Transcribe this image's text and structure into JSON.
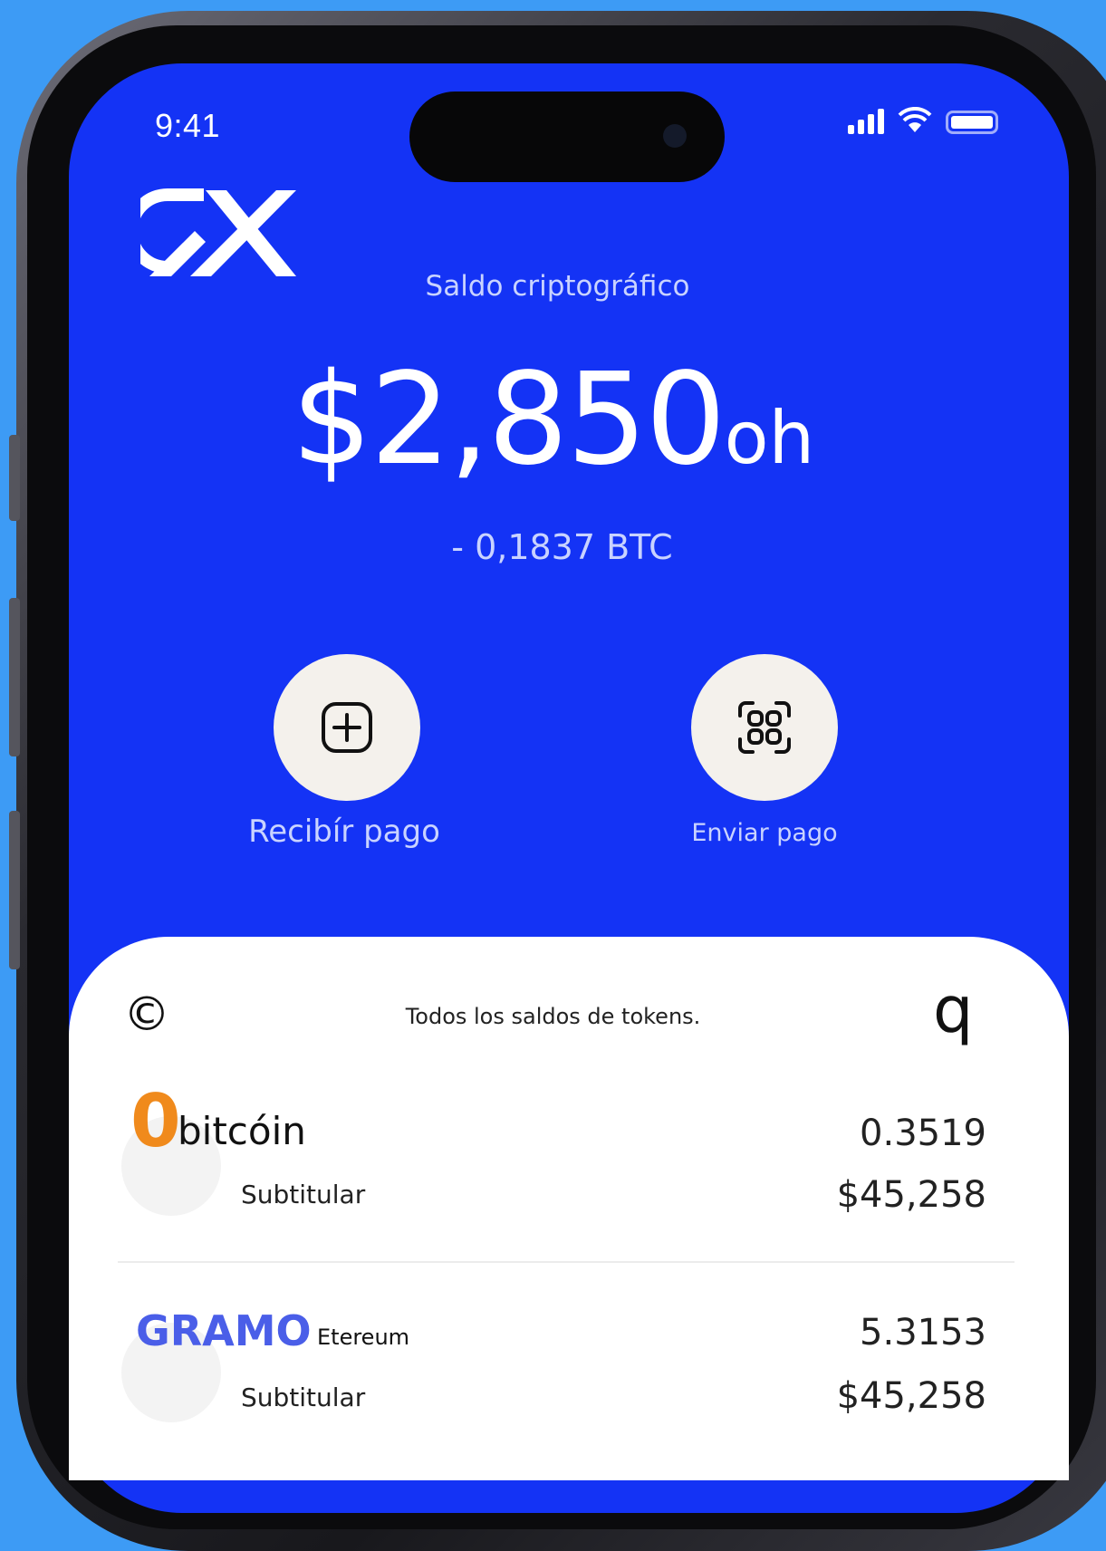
{
  "status_bar": {
    "time": "9:41"
  },
  "header": {
    "balance_label": "Saldo criptográfico",
    "balance_amount": "$2,850",
    "balance_suffix": "oh",
    "balance_btc": "- 0,1837 BTC"
  },
  "actions": {
    "receive_label": "Recibír pago",
    "send_label": "Enviar pago"
  },
  "tokens_panel": {
    "title": "Todos los saldos de tokens.",
    "left_icon_glyph": "©",
    "right_icon_glyph": "q",
    "items": [
      {
        "symbol": "0",
        "symbol_color": "#f08a1c",
        "name": "bitcóin",
        "subtitle": "Subtitular",
        "amount": "0.3519",
        "value": "$45,258"
      },
      {
        "symbol": "GRAMO",
        "symbol_color": "#4a5ee8",
        "name": "Etereum",
        "subtitle": "Subtitular",
        "amount": "5.3153",
        "value": "$45,258"
      }
    ]
  },
  "colors": {
    "background": "#3d9bf5",
    "screen_blue": "#1433f5",
    "button_fill": "#f4f1ec"
  }
}
